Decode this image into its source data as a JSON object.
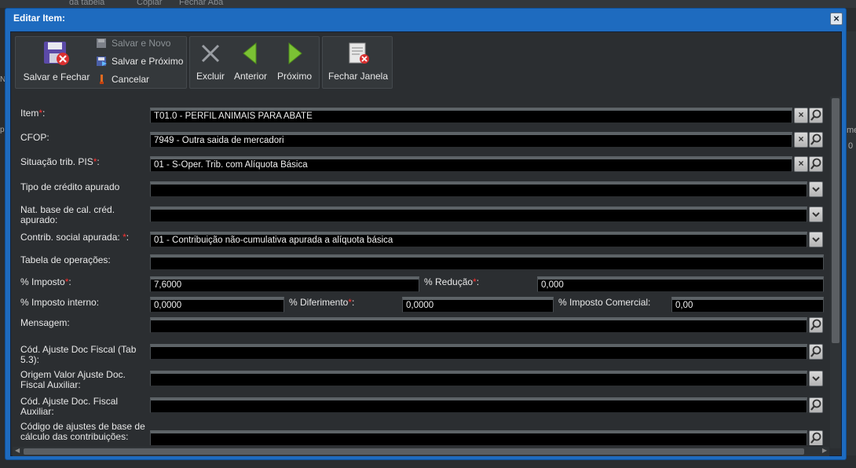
{
  "background": {
    "tab1": "da tabela",
    "tab2": "Copiar",
    "tab3": "Fechar Aba",
    "right1": "me",
    "right2": "0",
    "left1": "N",
    "left2": "p"
  },
  "dialog": {
    "title": "Editar Item:",
    "close_label": "×"
  },
  "toolbar": {
    "save_close": "Salvar e Fechar",
    "save_new": "Salvar e Novo",
    "save_next": "Salvar e Próximo",
    "cancel": "Cancelar",
    "delete": "Excluir",
    "previous": "Anterior",
    "next": "Próximo",
    "close_window": "Fechar Janela"
  },
  "form": {
    "item": {
      "label": "Item",
      "value": "T01.0 - PERFIL ANIMAIS PARA ABATE"
    },
    "cfop": {
      "label": "CFOP:",
      "value": "7949 - Outra saida de mercadori"
    },
    "pis": {
      "label": "Situação trib. PIS",
      "value": "01 - S-Oper. Trib. com Alíquota Básica"
    },
    "credit_type": {
      "label": "Tipo de crédito apurado",
      "value": ""
    },
    "nat_base": {
      "label": "Nat. base de cal. créd. apurado:",
      "value": ""
    },
    "contrib": {
      "label": "Contrib. social apurada: ",
      "value": "01 - Contribuição não-cumulativa apurada a alíquota básica"
    },
    "operations": {
      "label": "Tabela de operações:",
      "value": ""
    },
    "tax_pct": {
      "label": "% Imposto",
      "value": "7,6000"
    },
    "reduction": {
      "label": "% Redução",
      "value": "0,000"
    },
    "internal_tax": {
      "label": "% Imposto interno:",
      "value": "0,0000"
    },
    "deferral": {
      "label": "% Diferimento",
      "value": "0,0000"
    },
    "commercial_tax": {
      "label": "% Imposto Comercial:",
      "value": "0,00"
    },
    "message": {
      "label": "Mensagem:",
      "value": ""
    },
    "adj_code": {
      "label": "Cód. Ajuste Doc Fiscal (Tab 5.3):",
      "value": ""
    },
    "origin_adj": {
      "label": "Origem Valor Ajuste Doc. Fiscal Auxiliar:",
      "value": ""
    },
    "adj_code_aux": {
      "label": "Cód. Ajuste Doc. Fiscal Auxiliar:",
      "value": ""
    },
    "base_adj": {
      "label": "Código de ajustes de base de cálculo das contribuições:",
      "value": ""
    }
  }
}
